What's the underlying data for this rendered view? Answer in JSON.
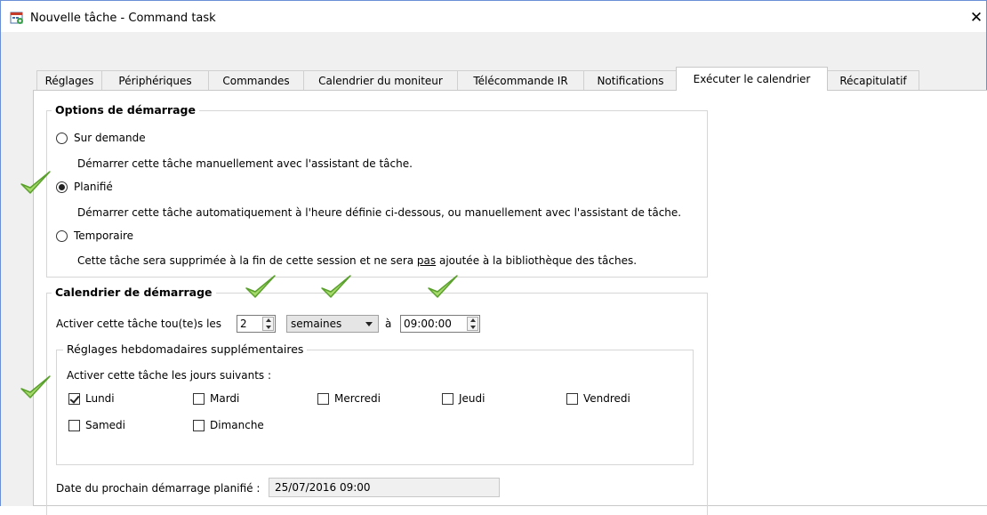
{
  "window": {
    "title": "Nouvelle tâche - Command task",
    "close_glyph": "✕"
  },
  "tabs": [
    {
      "label": "Réglages"
    },
    {
      "label": "Périphériques"
    },
    {
      "label": "Commandes"
    },
    {
      "label": "Calendrier du moniteur"
    },
    {
      "label": "Télécommande IR"
    },
    {
      "label": "Notifications"
    },
    {
      "label": "Exécuter le calendrier",
      "active": true
    },
    {
      "label": "Récapitulatif"
    }
  ],
  "startup_options": {
    "title": "Options de démarrage",
    "options": [
      {
        "label": "Sur demande",
        "description": "Démarrer cette tâche manuellement avec l'assistant de tâche.",
        "checked": false
      },
      {
        "label": "Planifié",
        "description": "Démarrer cette tâche automatiquement à l'heure définie ci-dessous, ou manuellement avec l'assistant de tâche.",
        "checked": true
      },
      {
        "label": "Temporaire",
        "description_before": "Cette tâche sera supprimée à la fin de cette session et ne sera ",
        "description_underlined": "pas",
        "description_after": " ajoutée à la bibliothèque des tâches.",
        "checked": false
      }
    ]
  },
  "schedule": {
    "title": "Calendrier de démarrage",
    "activate_label": "Activer cette tâche tou(te)s les",
    "interval_value": "2",
    "unit_value": "semaines",
    "at_label": "à",
    "time_value": "09:00:00",
    "weekly_group_title": "Réglages hebdomadaires supplémentaires",
    "days_prompt": "Activer cette tâche les jours suivants :",
    "days": [
      {
        "label": "Lundi",
        "checked": true
      },
      {
        "label": "Mardi",
        "checked": false
      },
      {
        "label": "Mercredi",
        "checked": false
      },
      {
        "label": "Jeudi",
        "checked": false
      },
      {
        "label": "Vendredi",
        "checked": false
      },
      {
        "label": "Samedi",
        "checked": false
      },
      {
        "label": "Dimanche",
        "checked": false
      }
    ],
    "next_start_label": "Date du prochain démarrage planifié :",
    "next_start_value": "25/07/2016 09:00"
  },
  "colors": {
    "annotation_check": "#7cc23a",
    "window_border": "#6a8fd6"
  }
}
